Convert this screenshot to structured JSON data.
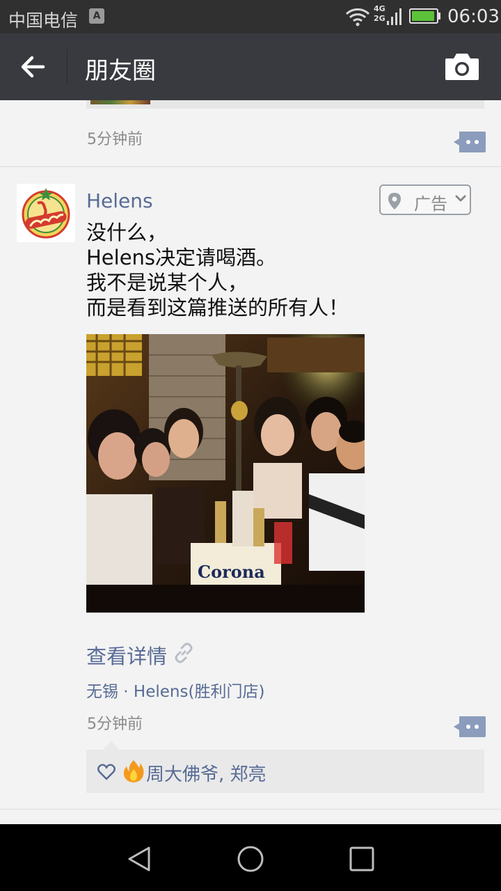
{
  "status_bar": {
    "carrier": "中国电信",
    "sim_badge": "A",
    "network_top": "4G",
    "network_bottom": "2G",
    "time": "06:03",
    "battery_level": 0.95,
    "battery_color": "#5bc239",
    "icons": [
      "sim-icon",
      "wifi-icon",
      "signal-icon",
      "battery-icon"
    ]
  },
  "header": {
    "title": "朋友圈",
    "back_icon": "back-arrow-icon",
    "camera_icon": "camera-icon"
  },
  "previous_post": {
    "time": "5分钟前",
    "comment_icon": "comment-icon"
  },
  "post": {
    "author": "Helens",
    "ad_label": "广告",
    "ad_icons": [
      "location-pin-icon",
      "chevron-down-icon"
    ],
    "text_lines": [
      "没什么，",
      "Helens决定请喝酒。",
      "我不是说某个人，",
      "而是看到这篇推送的所有人！"
    ],
    "detail_link": "查看详情",
    "location": "无锡 · Helens(胜利门店)",
    "time": "5分钟前",
    "likes": {
      "names": "周大佛爷, 郑亮",
      "icons": [
        "heart-icon",
        "fire-emoji"
      ]
    }
  },
  "colors": {
    "link_blue": "#576b95",
    "title_bar": "#393a3f",
    "status_bar": "#303030"
  }
}
